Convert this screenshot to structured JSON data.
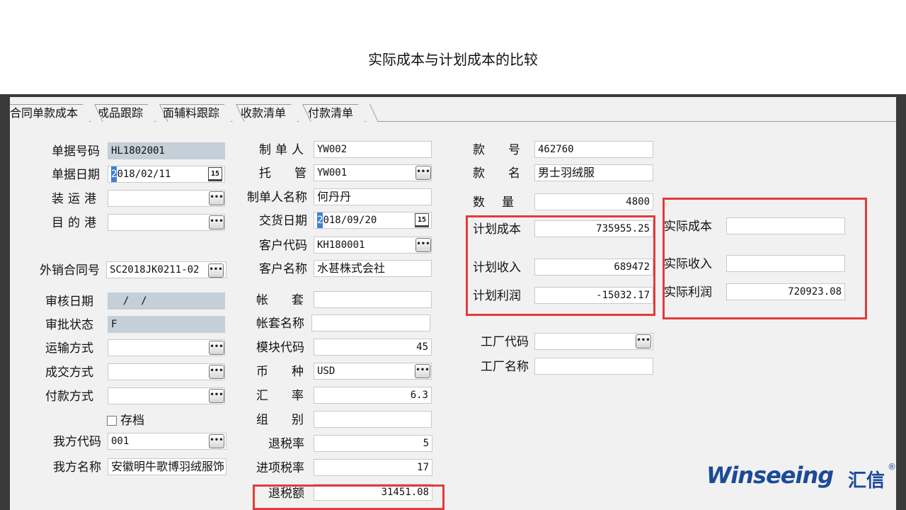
{
  "slide": {
    "title": "实际成本与计划成本的比较"
  },
  "tabs": [
    {
      "label": "合同单款成本"
    },
    {
      "label": "成品跟踪"
    },
    {
      "label": "面辅料跟踪"
    },
    {
      "label": "收款清单"
    },
    {
      "label": "付款清单"
    }
  ],
  "col1": {
    "doc_no": {
      "label": "单据号码",
      "value": "HL1802001"
    },
    "doc_date": {
      "label": "单据日期",
      "caret": "2",
      "value": "018/02/11"
    },
    "load_port": {
      "label": "装运港",
      "value": ""
    },
    "dest_port": {
      "label": "目的港",
      "value": ""
    },
    "export_contract": {
      "label": "外销合同号",
      "value": "SC2018JK0211-02"
    },
    "audit_date": {
      "label": "审核日期",
      "value": "  /  /"
    },
    "approval_status": {
      "label": "审批状态",
      "value": "F"
    },
    "transport": {
      "label": "运输方式",
      "value": ""
    },
    "deal_method": {
      "label": "成交方式",
      "value": ""
    },
    "payment_method": {
      "label": "付款方式",
      "value": ""
    },
    "archive": {
      "label": "存档"
    },
    "our_code": {
      "label": "我方代码",
      "value": "001"
    },
    "our_name": {
      "label": "我方名称",
      "value": "安徽明牛歌博羽绒服饰"
    }
  },
  "col2": {
    "maker": {
      "label": "制单人",
      "value": "YW002"
    },
    "custodian": {
      "label": "托管",
      "value": "YW001"
    },
    "maker_name": {
      "label": "制单人名称",
      "value": "何丹丹"
    },
    "delivery_date": {
      "label": "交货日期",
      "caret": "2",
      "value": "018/09/20"
    },
    "customer_code": {
      "label": "客户代码",
      "value": "KH180001"
    },
    "customer_name": {
      "label": "客户名称",
      "value": "水甚株式会社"
    },
    "account_set": {
      "label": "帐套",
      "value": ""
    },
    "account_set_name": {
      "label": "帐套名称",
      "value": ""
    },
    "module_code": {
      "label": "模块代码",
      "value": "45"
    },
    "currency": {
      "label": "币种",
      "value": "USD"
    },
    "exchange_rate": {
      "label": "汇率",
      "value": "6.3"
    },
    "group": {
      "label": "组别",
      "value": ""
    },
    "tax_refund_rate": {
      "label": "退税率",
      "value": "5"
    },
    "input_tax_rate": {
      "label": "进项税率",
      "value": "17"
    },
    "tax_refund_amount": {
      "label": "退税额",
      "value": "31451.08"
    }
  },
  "col3": {
    "style_no": {
      "label": "款号",
      "value": "462760"
    },
    "style_name": {
      "label": "款名",
      "value": "男士羽绒服"
    },
    "quantity": {
      "label": "数量",
      "value": "4800"
    },
    "plan_cost": {
      "label": "计划成本",
      "value": "735955.25"
    },
    "plan_income": {
      "label": "计划收入",
      "value": "689472"
    },
    "plan_profit": {
      "label": "计划利润",
      "value": "-15032.17"
    },
    "factory_code": {
      "label": "工厂代码",
      "value": ""
    },
    "factory_name": {
      "label": "工厂名称",
      "value": ""
    }
  },
  "col4": {
    "actual_cost": {
      "label": "实际成本",
      "value": ""
    },
    "actual_income": {
      "label": "实际收入",
      "value": ""
    },
    "actual_profit": {
      "label": "实际利润",
      "value": "720923.08"
    }
  },
  "logo": {
    "main": "Winseeing",
    "cjk": "汇信",
    "mark": "®"
  },
  "buttons": {
    "lookup_glyph": "•••",
    "calendar_glyph": "15"
  },
  "colors": {
    "highlight_red": "#e23b3b",
    "readonly_field": "#c5cfd8",
    "logo_blue": "#1c4a98"
  }
}
